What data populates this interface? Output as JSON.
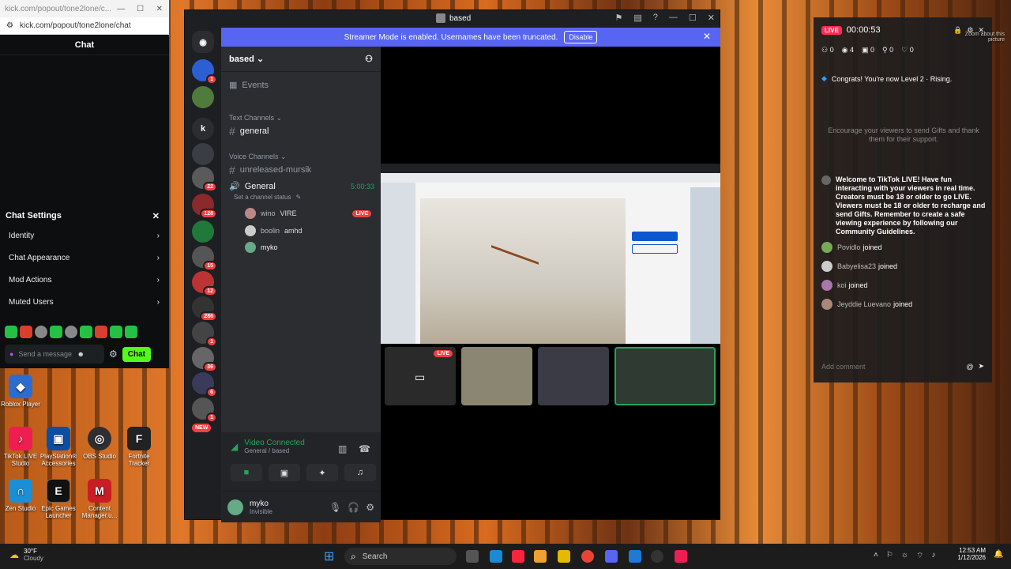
{
  "kick": {
    "tab_title": "kick.com/popout/tone2lone/c...",
    "url": "kick.com/popout/tone2lone/chat",
    "chat_header": "Chat",
    "settings_title": "Chat Settings",
    "settings_items": [
      "Identity",
      "Chat Appearance",
      "Mod Actions",
      "Muted Users"
    ],
    "message_placeholder": "Send a message",
    "chat_button": "Chat",
    "accent_color": "#53fc18"
  },
  "desktop_icons": [
    {
      "label": "Roblox Player",
      "icon": "roblox-icon"
    },
    {
      "label": "TikTok LIVE Studio",
      "icon": "tiktok-icon"
    },
    {
      "label": "PlayStation® Accessories",
      "icon": "playstation-icon"
    },
    {
      "label": "OBS Studio",
      "icon": "obs-icon"
    },
    {
      "label": "Fortnite Tracker",
      "icon": "fortnite-icon"
    },
    {
      "label": "Zen Studio",
      "icon": "zen-icon"
    },
    {
      "label": "Epic Games Launcher",
      "icon": "epic-icon"
    },
    {
      "label": "Content Manager.u...",
      "icon": "content-manager-icon"
    }
  ],
  "discord": {
    "window_title": "based",
    "banner_text": "Streamer Mode is enabled. Usernames have been truncated.",
    "banner_button": "Disable",
    "server_name": "based",
    "events_label": "Events",
    "text_channels_label": "Text Channels",
    "text_channels": [
      "general"
    ],
    "voice_channels_label": "Voice Channels",
    "voice_channels": [
      "unreleased-mursik",
      "General"
    ],
    "voice_timer": "5:00:33",
    "channel_status_hint": "Set a channel status",
    "voice_users": [
      {
        "name": "wino",
        "tag": "VIRE",
        "live": "LIVE"
      },
      {
        "name": "boolin",
        "tag": "amhd"
      },
      {
        "name": "myko"
      }
    ],
    "guild_badges": [
      "1",
      "22",
      "128",
      "15",
      "12",
      "286",
      "1",
      "36",
      "6",
      "1"
    ],
    "new_label": "NEW",
    "connection_status": "Video Connected",
    "connection_sub": "General / based",
    "user_name": "myko",
    "user_status": "Invisible",
    "tile_live": "LIVE",
    "accent_color": "#5865f2"
  },
  "tiktok": {
    "live_label": "LIVE",
    "timer": "00:00:53",
    "stats": [
      "0",
      "4",
      "0",
      "0",
      "0"
    ],
    "level_msg": "Congrats! You're now Level 2 · Rising.",
    "encourage_msg": "Encourage your viewers to send Gifts and thank them for their support.",
    "welcome_msg": "Welcome to TikTok LIVE! Have fun interacting with your viewers in real time. Creators must be 18 or older to go LIVE. Viewers must be 18 or older to recharge and send Gifts. Remember to create a safe viewing experience by following our Community Guidelines.",
    "joins": [
      {
        "name": "Povidlo",
        "action": "joined"
      },
      {
        "name": "Babyelisa23",
        "action": "joined"
      },
      {
        "name": "koi",
        "action": "joined"
      },
      {
        "name": "Jeyddie Luevano",
        "action": "joined"
      }
    ],
    "comment_placeholder": "Add comment",
    "zoom_label": "Zoom about this picture"
  },
  "taskbar": {
    "weather_temp": "30°F",
    "weather_desc": "Cloudy",
    "search_placeholder": "Search",
    "time": "12:53 AM",
    "date": "1/12/2026"
  }
}
